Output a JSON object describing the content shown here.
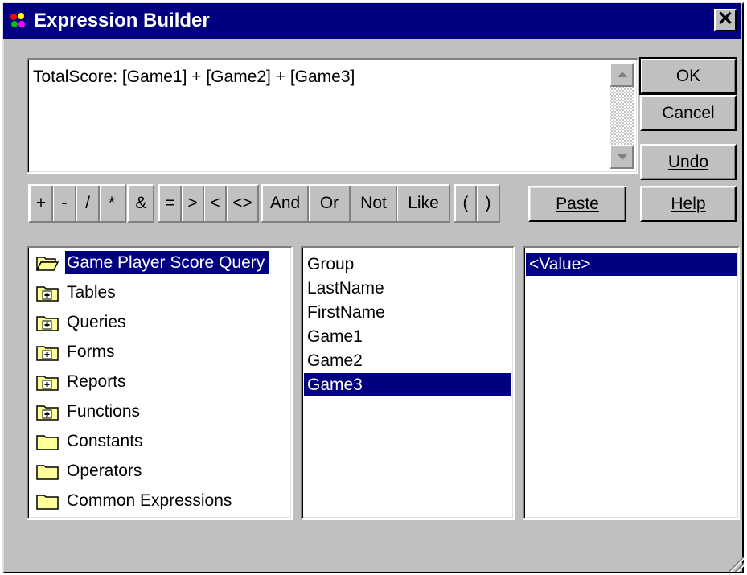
{
  "window": {
    "title": "Expression Builder",
    "close_label": "✕"
  },
  "expression": {
    "text": "TotalScore: [Game1] + [Game2] + [Game3]"
  },
  "buttons": {
    "ok": "OK",
    "cancel": "Cancel",
    "undo": "Undo",
    "paste": "Paste",
    "help": "Help"
  },
  "operators": {
    "arith": [
      "+",
      "-",
      "/",
      "*"
    ],
    "concat": [
      "&"
    ],
    "compare": [
      "=",
      ">",
      "<",
      "<>"
    ],
    "logic": [
      "And",
      "Or",
      "Not",
      "Like"
    ],
    "parens": [
      "(",
      ")"
    ]
  },
  "tree": {
    "items": [
      {
        "label": "Game Player Score Query",
        "icon": "open-folder-icon",
        "selected": true
      },
      {
        "label": "Tables",
        "icon": "plus-folder-icon"
      },
      {
        "label": "Queries",
        "icon": "plus-folder-icon"
      },
      {
        "label": "Forms",
        "icon": "plus-folder-icon"
      },
      {
        "label": "Reports",
        "icon": "plus-folder-icon"
      },
      {
        "label": "Functions",
        "icon": "plus-folder-icon"
      },
      {
        "label": "Constants",
        "icon": "folder-icon"
      },
      {
        "label": "Operators",
        "icon": "folder-icon"
      },
      {
        "label": "Common Expressions",
        "icon": "folder-icon"
      }
    ]
  },
  "fields": {
    "items": [
      "Group",
      "LastName",
      "FirstName",
      "Game1",
      "Game2",
      "Game3"
    ],
    "selected": "Game3"
  },
  "values": {
    "items": [
      "<Value>"
    ],
    "selected": "<Value>"
  },
  "colors": {
    "titlebar": "#000080",
    "face": "#c0c0c0",
    "selection": "#000080",
    "folder": "#ffff99"
  }
}
